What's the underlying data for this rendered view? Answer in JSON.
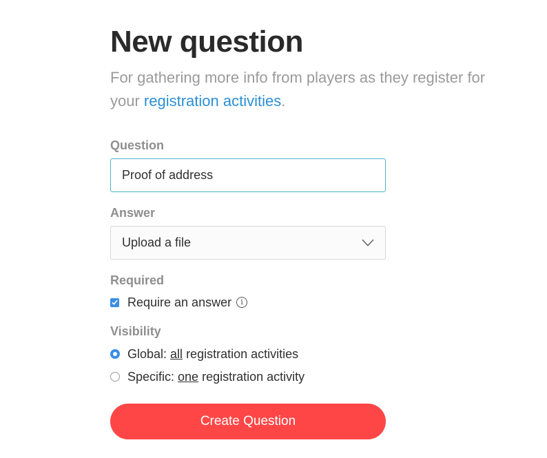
{
  "header": {
    "title": "New question",
    "subtitle_prefix": "For gathering more info from players as they register for your",
    "subtitle_link": "registration activities",
    "subtitle_suffix": "."
  },
  "form": {
    "question_label": "Question",
    "question_value": "Proof of address",
    "answer_label": "Answer",
    "answer_value": "Upload a file",
    "required_label": "Required",
    "require_answer_label": "Require an answer",
    "require_answer_checked": true,
    "info_glyph": "i",
    "visibility_label": "Visibility",
    "visibility_options": [
      {
        "prefix": "Global: ",
        "underlined": "all",
        "suffix": " registration activities",
        "checked": true
      },
      {
        "prefix": "Specific: ",
        "underlined": "one",
        "suffix": " registration activity",
        "checked": false
      }
    ],
    "submit_label": "Create Question"
  },
  "colors": {
    "accent_blue": "#3a8ee6",
    "link_blue": "#2b8fd6",
    "submit_red": "#ff4646",
    "focus_border": "#4bb2c9"
  },
  "icons": {
    "select_chevron": "chevron-down-icon",
    "info": "info-icon",
    "checkmark": "checkmark-icon"
  }
}
